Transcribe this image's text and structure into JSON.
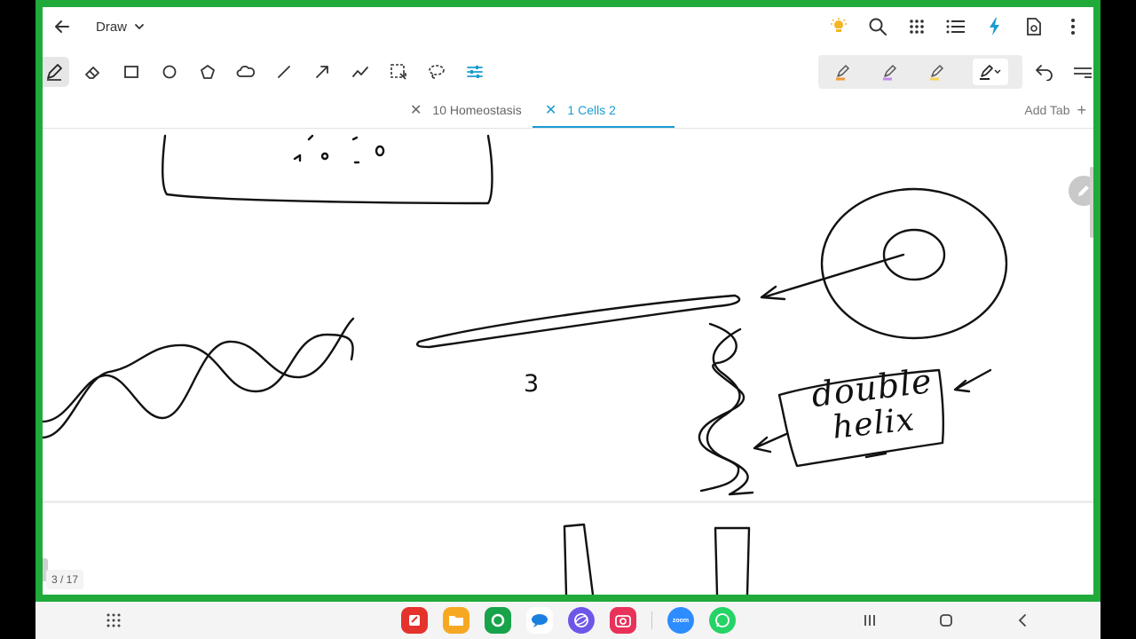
{
  "app": {
    "title": "Draw",
    "back_icon": "arrow-left-icon",
    "top_icons": [
      "tips-bulb-icon",
      "search-icon",
      "grid-icon",
      "list-icon",
      "flash-icon",
      "doc-settings-icon",
      "more-vert-icon"
    ]
  },
  "toolbar": {
    "tools": [
      "pen-icon",
      "eraser-icon",
      "rectangle-icon",
      "circle-icon",
      "pentagon-icon",
      "cloud-icon",
      "line-icon",
      "arrow-icon",
      "polyline-icon",
      "select-rect-icon",
      "lasso-icon",
      "adjust-icon"
    ],
    "pens": [
      {
        "name": "orange-highlighter",
        "color": "#f09a36"
      },
      {
        "name": "purple-highlighter",
        "color": "#c58be6"
      },
      {
        "name": "yellow-highlighter",
        "color": "#f3d35a"
      },
      {
        "name": "black-pen",
        "color": "#222222"
      }
    ],
    "undo_icon": "undo-icon"
  },
  "tabs": [
    {
      "label": "10 Homeostasis",
      "active": false
    },
    {
      "label": "1 Cells 2",
      "active": true
    }
  ],
  "add_tab_label": "Add Tab",
  "canvas": {
    "number_label": "3",
    "annotation_text_1": "double",
    "annotation_text_2": "helix",
    "page_indicator": "3 / 17"
  },
  "navbar": {
    "dock_apps": [
      {
        "name": "notes-app",
        "color": "#e5322d"
      },
      {
        "name": "files-app",
        "color": "#f7a823"
      },
      {
        "name": "phone-app",
        "color": "#17a34a"
      },
      {
        "name": "messages-app",
        "color": "#ffffff"
      },
      {
        "name": "internet-app",
        "color": "#6d57e8"
      },
      {
        "name": "camera-app",
        "color": "#e8325a"
      },
      {
        "name": "zoom-app",
        "color": "#2d8cff",
        "label": "zoom"
      },
      {
        "name": "whatsapp-app",
        "color": "#25d366"
      }
    ]
  },
  "colors": {
    "accent": "#1b9bd1",
    "frame": "#1faa3a",
    "ink": "#111111"
  }
}
